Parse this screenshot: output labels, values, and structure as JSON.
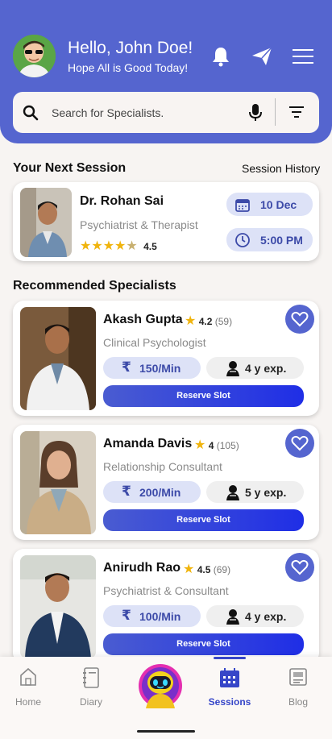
{
  "header": {
    "greeting": "Hello, John Doe!",
    "subtitle": "Hope All is Good Today!",
    "accent": "#5565cf"
  },
  "search": {
    "placeholder": "Search for Specialists."
  },
  "next_session": {
    "title": "Your Next Session",
    "history_link": "Session History",
    "doctor": "Dr. Rohan Sai",
    "role": "Psychiatrist & Therapist",
    "rating": "4.5",
    "date": "10 Dec",
    "time": "5:00 PM"
  },
  "recommended": {
    "title": "Recommended Specialists",
    "reserve_label": "Reserve Slot",
    "items": [
      {
        "name": "Akash Gupta",
        "rating": "4.2",
        "count": "(59)",
        "role": "Clinical Psychologist",
        "price": "150/Min",
        "exp": "4 y exp."
      },
      {
        "name": "Amanda Davis",
        "rating": "4",
        "count": "(105)",
        "role": "Relationship Consultant",
        "price": "200/Min",
        "exp": "5 y exp."
      },
      {
        "name": "Anirudh Rao",
        "rating": "4.5",
        "count": "(69)",
        "role": "Psychiatrist & Consultant",
        "price": "100/Min",
        "exp": "4 y exp."
      }
    ]
  },
  "nav": {
    "items": [
      {
        "label": "Home",
        "icon": "home-icon"
      },
      {
        "label": "Diary",
        "icon": "diary-icon"
      },
      {
        "label": "",
        "icon": "robot-assistant-icon"
      },
      {
        "label": "Sessions",
        "icon": "calendar-icon"
      },
      {
        "label": "Blog",
        "icon": "blog-icon"
      }
    ],
    "active": "Sessions"
  }
}
